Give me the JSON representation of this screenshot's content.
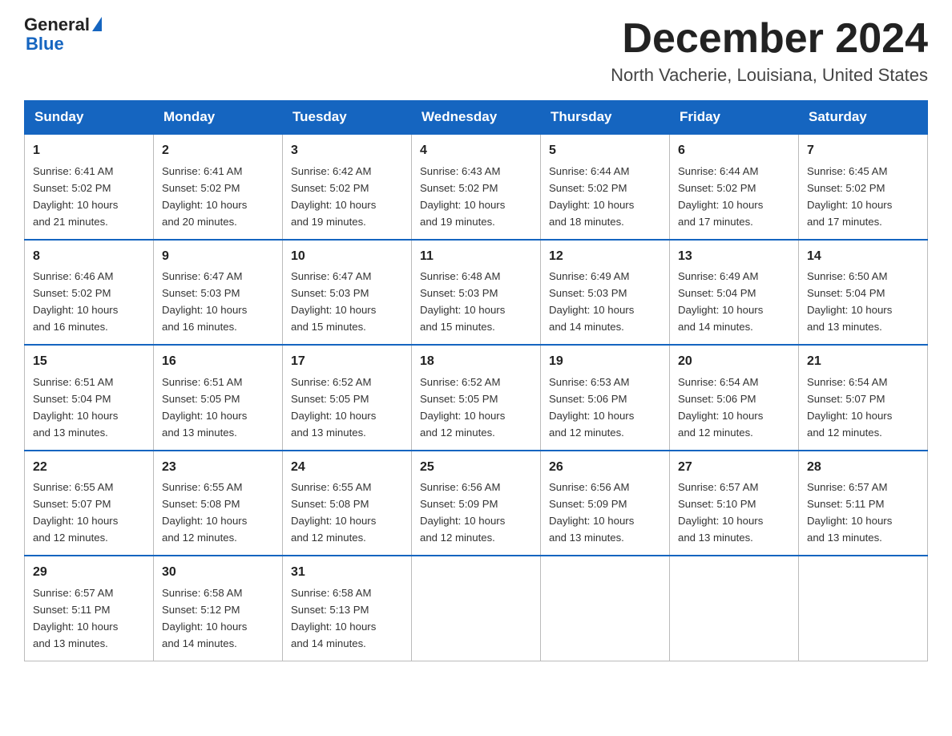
{
  "logo": {
    "general": "General",
    "blue": "Blue"
  },
  "header": {
    "month": "December 2024",
    "location": "North Vacherie, Louisiana, United States"
  },
  "days_of_week": [
    "Sunday",
    "Monday",
    "Tuesday",
    "Wednesday",
    "Thursday",
    "Friday",
    "Saturday"
  ],
  "weeks": [
    [
      {
        "day": "1",
        "sunrise": "6:41 AM",
        "sunset": "5:02 PM",
        "daylight": "10 hours and 21 minutes."
      },
      {
        "day": "2",
        "sunrise": "6:41 AM",
        "sunset": "5:02 PM",
        "daylight": "10 hours and 20 minutes."
      },
      {
        "day": "3",
        "sunrise": "6:42 AM",
        "sunset": "5:02 PM",
        "daylight": "10 hours and 19 minutes."
      },
      {
        "day": "4",
        "sunrise": "6:43 AM",
        "sunset": "5:02 PM",
        "daylight": "10 hours and 19 minutes."
      },
      {
        "day": "5",
        "sunrise": "6:44 AM",
        "sunset": "5:02 PM",
        "daylight": "10 hours and 18 minutes."
      },
      {
        "day": "6",
        "sunrise": "6:44 AM",
        "sunset": "5:02 PM",
        "daylight": "10 hours and 17 minutes."
      },
      {
        "day": "7",
        "sunrise": "6:45 AM",
        "sunset": "5:02 PM",
        "daylight": "10 hours and 17 minutes."
      }
    ],
    [
      {
        "day": "8",
        "sunrise": "6:46 AM",
        "sunset": "5:02 PM",
        "daylight": "10 hours and 16 minutes."
      },
      {
        "day": "9",
        "sunrise": "6:47 AM",
        "sunset": "5:03 PM",
        "daylight": "10 hours and 16 minutes."
      },
      {
        "day": "10",
        "sunrise": "6:47 AM",
        "sunset": "5:03 PM",
        "daylight": "10 hours and 15 minutes."
      },
      {
        "day": "11",
        "sunrise": "6:48 AM",
        "sunset": "5:03 PM",
        "daylight": "10 hours and 15 minutes."
      },
      {
        "day": "12",
        "sunrise": "6:49 AM",
        "sunset": "5:03 PM",
        "daylight": "10 hours and 14 minutes."
      },
      {
        "day": "13",
        "sunrise": "6:49 AM",
        "sunset": "5:04 PM",
        "daylight": "10 hours and 14 minutes."
      },
      {
        "day": "14",
        "sunrise": "6:50 AM",
        "sunset": "5:04 PM",
        "daylight": "10 hours and 13 minutes."
      }
    ],
    [
      {
        "day": "15",
        "sunrise": "6:51 AM",
        "sunset": "5:04 PM",
        "daylight": "10 hours and 13 minutes."
      },
      {
        "day": "16",
        "sunrise": "6:51 AM",
        "sunset": "5:05 PM",
        "daylight": "10 hours and 13 minutes."
      },
      {
        "day": "17",
        "sunrise": "6:52 AM",
        "sunset": "5:05 PM",
        "daylight": "10 hours and 13 minutes."
      },
      {
        "day": "18",
        "sunrise": "6:52 AM",
        "sunset": "5:05 PM",
        "daylight": "10 hours and 12 minutes."
      },
      {
        "day": "19",
        "sunrise": "6:53 AM",
        "sunset": "5:06 PM",
        "daylight": "10 hours and 12 minutes."
      },
      {
        "day": "20",
        "sunrise": "6:54 AM",
        "sunset": "5:06 PM",
        "daylight": "10 hours and 12 minutes."
      },
      {
        "day": "21",
        "sunrise": "6:54 AM",
        "sunset": "5:07 PM",
        "daylight": "10 hours and 12 minutes."
      }
    ],
    [
      {
        "day": "22",
        "sunrise": "6:55 AM",
        "sunset": "5:07 PM",
        "daylight": "10 hours and 12 minutes."
      },
      {
        "day": "23",
        "sunrise": "6:55 AM",
        "sunset": "5:08 PM",
        "daylight": "10 hours and 12 minutes."
      },
      {
        "day": "24",
        "sunrise": "6:55 AM",
        "sunset": "5:08 PM",
        "daylight": "10 hours and 12 minutes."
      },
      {
        "day": "25",
        "sunrise": "6:56 AM",
        "sunset": "5:09 PM",
        "daylight": "10 hours and 12 minutes."
      },
      {
        "day": "26",
        "sunrise": "6:56 AM",
        "sunset": "5:09 PM",
        "daylight": "10 hours and 13 minutes."
      },
      {
        "day": "27",
        "sunrise": "6:57 AM",
        "sunset": "5:10 PM",
        "daylight": "10 hours and 13 minutes."
      },
      {
        "day": "28",
        "sunrise": "6:57 AM",
        "sunset": "5:11 PM",
        "daylight": "10 hours and 13 minutes."
      }
    ],
    [
      {
        "day": "29",
        "sunrise": "6:57 AM",
        "sunset": "5:11 PM",
        "daylight": "10 hours and 13 minutes."
      },
      {
        "day": "30",
        "sunrise": "6:58 AM",
        "sunset": "5:12 PM",
        "daylight": "10 hours and 14 minutes."
      },
      {
        "day": "31",
        "sunrise": "6:58 AM",
        "sunset": "5:13 PM",
        "daylight": "10 hours and 14 minutes."
      },
      null,
      null,
      null,
      null
    ]
  ],
  "labels": {
    "sunrise": "Sunrise:",
    "sunset": "Sunset:",
    "daylight": "Daylight:"
  }
}
